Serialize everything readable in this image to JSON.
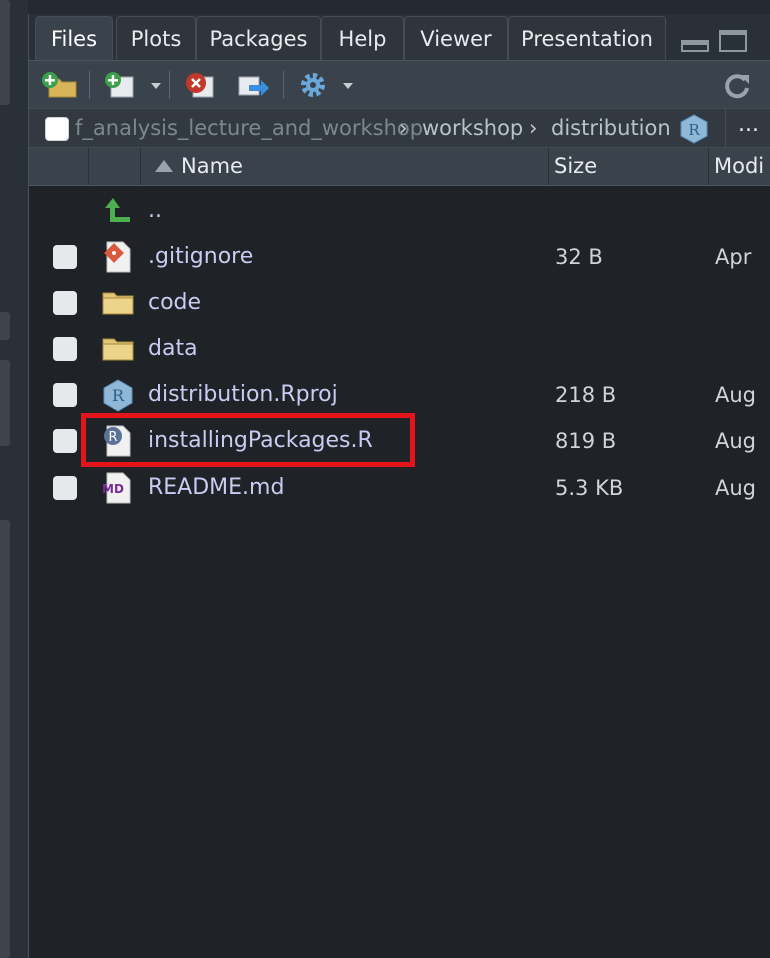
{
  "tabs": [
    {
      "label": "Files",
      "active": true
    },
    {
      "label": "Plots",
      "active": false
    },
    {
      "label": "Packages",
      "active": false
    },
    {
      "label": "Help",
      "active": false
    },
    {
      "label": "Viewer",
      "active": false
    },
    {
      "label": "Presentation",
      "active": false
    }
  ],
  "toolbar": {
    "icons": [
      "new-folder-icon",
      "new-file-icon",
      "delete-icon",
      "rename-icon",
      "gear-icon",
      "refresh-icon"
    ]
  },
  "path": {
    "crumbs": [
      "f_analysis_lecture_and_workshop",
      "workshop",
      "distribution"
    ],
    "more": "..."
  },
  "columns": {
    "name": "Name",
    "size": "Size",
    "modified": "Modi"
  },
  "files": [
    {
      "name": "..",
      "size": "",
      "modified": "",
      "icon": "up-arrow-icon"
    },
    {
      "name": ".gitignore",
      "size": "32 B",
      "modified": "Apr",
      "icon": "git-file-icon"
    },
    {
      "name": "code",
      "size": "",
      "modified": "",
      "icon": "folder-icon"
    },
    {
      "name": "data",
      "size": "",
      "modified": "",
      "icon": "folder-icon"
    },
    {
      "name": "distribution.Rproj",
      "size": "218 B",
      "modified": "Aug",
      "icon": "rproj-icon"
    },
    {
      "name": "installingPackages.R",
      "size": "819 B",
      "modified": "Aug",
      "icon": "r-script-icon"
    },
    {
      "name": "README.md",
      "size": "5.3 KB",
      "modified": "Aug",
      "icon": "markdown-file-icon"
    }
  ],
  "colors": {
    "highlight": "#e3141a",
    "file_name": "#c8ccf0",
    "background": "#1f2226"
  }
}
